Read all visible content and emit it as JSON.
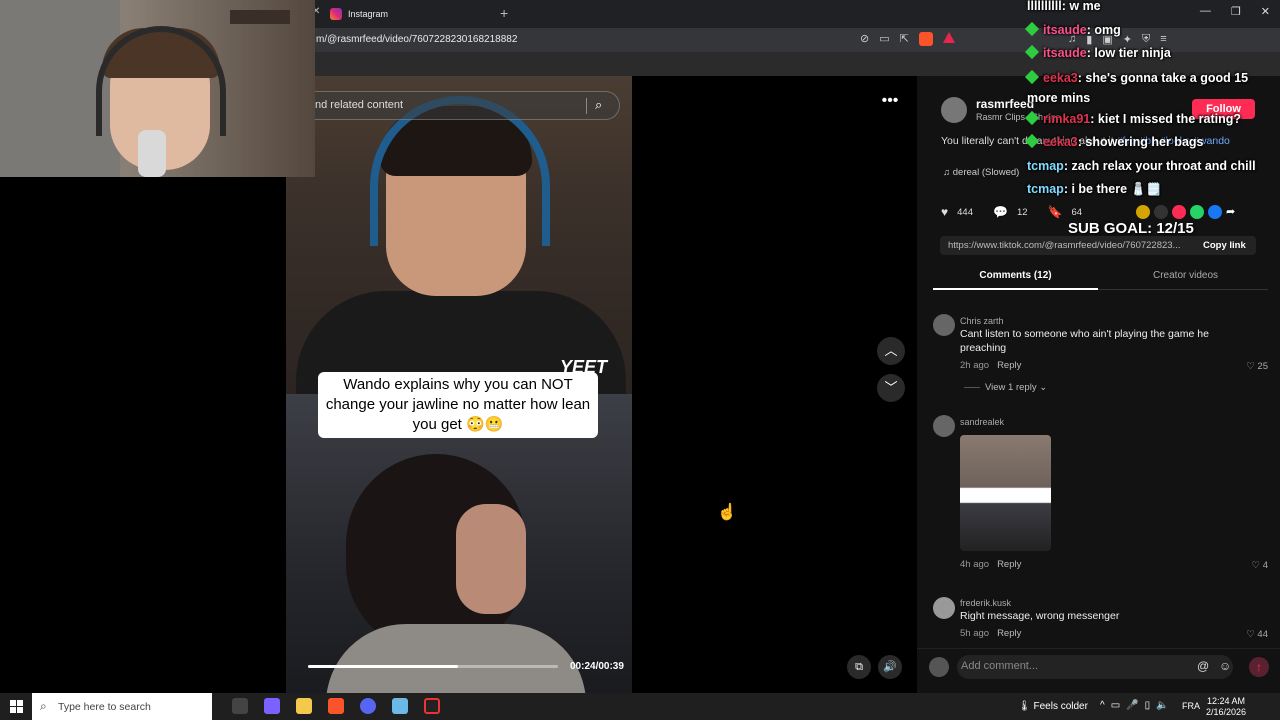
{
  "browser": {
    "tab_title": "Instagram",
    "url": "m/@rasmrfeed/video/7607228230168218882"
  },
  "video": {
    "search_placeholder": "nd related content",
    "caption": "Wando explains why you can NOT change your jawline no matter how lean you get 😳😬",
    "watermark": "YEET",
    "time": "00:24/00:39",
    "progress": 0.6
  },
  "post": {
    "username": "rasmrfeed",
    "display": "Rasmr Clips · 6h ago",
    "follow_label": "Follow",
    "description_text": "You literally can't do anything about it ",
    "tags": [
      "#fyp",
      "#bp",
      "#looks",
      "#wando"
    ],
    "music": "dereal (Slowed)",
    "likes": "444",
    "comments": "12",
    "saves": "64",
    "link": "https://www.tiktok.com/@rasmrfeed/video/760722823...",
    "copy_link": "Copy link"
  },
  "tabs": {
    "comments": "Comments (12)",
    "creator": "Creator videos"
  },
  "comments": [
    {
      "name": "Chris zarth",
      "text": "Cant listen to someone who ain't playing the game he preaching",
      "time": "2h ago",
      "reply": "Reply",
      "likes": "25"
    },
    {
      "name": "sandrealek",
      "text": "",
      "time": "4h ago",
      "reply": "Reply",
      "likes": "4"
    },
    {
      "name": "frederik.kusk",
      "text": "Right message, wrong messenger",
      "time": "5h ago",
      "reply": "Reply",
      "likes": "44"
    }
  ],
  "view_reply": "View 1 reply",
  "comment_bar": {
    "placeholder": "Add comment..."
  },
  "chat": [
    {
      "user": "llllllllll",
      "msg": ": w me",
      "color": "#ffffff"
    },
    {
      "user": "itsaude",
      "msg": ": omg",
      "color": "#ff4f8b"
    },
    {
      "user": "itsaude",
      "msg": ": low tier ninja",
      "color": "#ff4f8b"
    },
    {
      "user": "eeka3",
      "msg": ": she's gonna take a good 15 more mins",
      "color": "#e0334d"
    },
    {
      "user": "rimka91",
      "msg": ": kiet I missed the rating?",
      "color": "#e0334d"
    },
    {
      "user": "eeka3",
      "msg": ": showering her bags",
      "color": "#e0334d"
    },
    {
      "user": "tcmap",
      "msg": ": zach relax your throat and chill",
      "color": "#7fdbff"
    },
    {
      "user": "tcmap",
      "msg": ": i be there 🧂🗒️",
      "color": "#7fdbff"
    }
  ],
  "sub_goal": "SUB GOAL: 12/15",
  "taskbar": {
    "search_text": "Type here to search",
    "weather": "Feels colder",
    "lang": "FRA",
    "time": "12:24 AM",
    "date": "2/16/2026"
  },
  "colors": {
    "accent": "#fe2c55",
    "tag": "#6ea8fe",
    "panel_bg": "#121212"
  }
}
